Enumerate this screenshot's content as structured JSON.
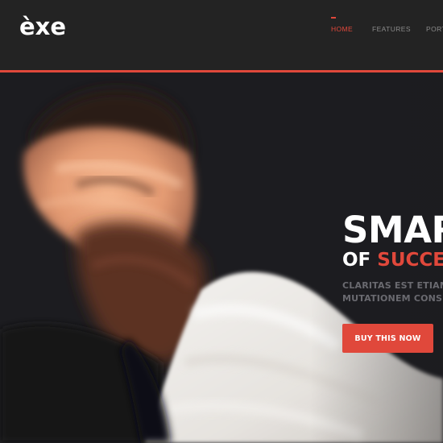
{
  "brand": {
    "logo_text": "èxe"
  },
  "nav": {
    "items": [
      {
        "label": "HOME",
        "active": true
      },
      {
        "label": "FEATURES",
        "active": false
      },
      {
        "label": "PORTFOLIO",
        "active": false
      }
    ]
  },
  "hero": {
    "title": "SMART THEME",
    "subtitle_prefix": "OF ",
    "subtitle_accent": "SUCCESS",
    "text_line_1": "CLARITAS EST ETIAM PROCESSUS DYNAMICUS",
    "text_line_2": "MUTATIONEM CONSUETUDIUM LECTORUM",
    "cta_label": "BUY THIS NOW"
  },
  "colors": {
    "accent": "#e0483b",
    "header_bg": "#232323",
    "hero_bg": "#1b1b1e",
    "nav_text": "#8a8a8a",
    "muted_text": "#6a6a70"
  }
}
